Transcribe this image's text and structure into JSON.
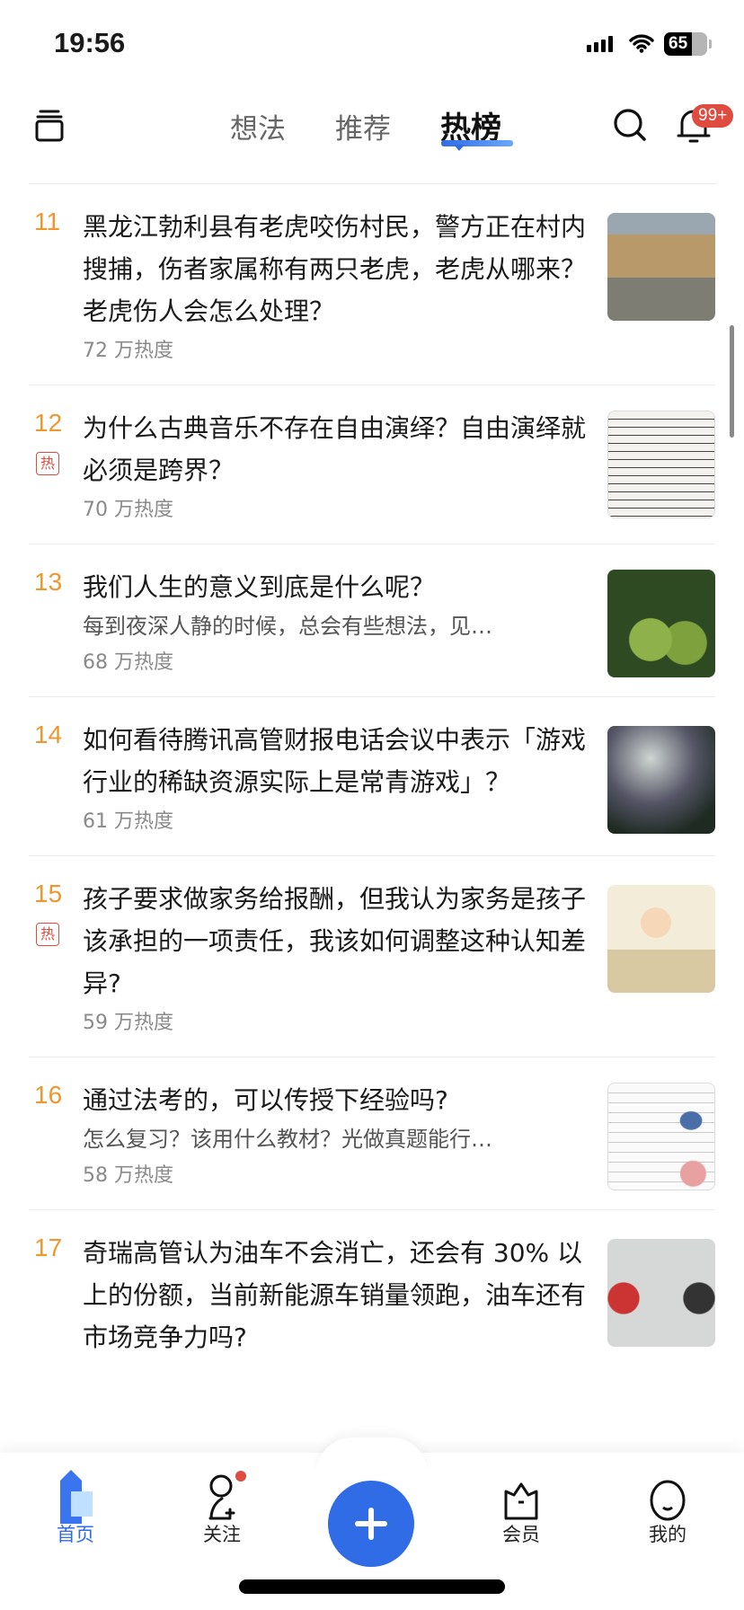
{
  "status_bar": {
    "time": "19:56",
    "battery": "65"
  },
  "header": {
    "tabs": [
      {
        "label": "想法"
      },
      {
        "label": "推荐"
      },
      {
        "label": "热榜"
      }
    ],
    "notification_badge": "99+"
  },
  "hot_list": [
    {
      "rank": "11",
      "title": "黑龙江勃利县有老虎咬伤村民，警方正在村内搜捕，伤者家属称有两只老虎，老虎从哪来？老虎伤人会怎么处理？",
      "heat": "72 万热度",
      "hot": false
    },
    {
      "rank": "12",
      "title": "为什么古典音乐不存在自由演绎？自由演绎就必须是跨界？",
      "heat": "70 万热度",
      "hot": true,
      "hot_label": "热"
    },
    {
      "rank": "13",
      "title": "我们人生的意义到底是什么呢？",
      "desc": "每到夜深人静的时候，总会有些想法，见…",
      "heat": "68 万热度",
      "hot": false
    },
    {
      "rank": "14",
      "title": "如何看待腾讯高管财报电话会议中表示「游戏行业的稀缺资源实际上是常青游戏」？",
      "heat": "61 万热度",
      "hot": false
    },
    {
      "rank": "15",
      "title": "孩子要求做家务给报酬，但我认为家务是孩子该承担的一项责任，我该如何调整这种认知差异?",
      "heat": "59 万热度",
      "hot": true,
      "hot_label": "热"
    },
    {
      "rank": "16",
      "title": "通过法考的，可以传授下经验吗?",
      "desc": "怎么复习？该用什么教材？光做真题能行…",
      "heat": "58 万热度",
      "hot": false
    },
    {
      "rank": "17",
      "title": "奇瑞高管认为油车不会消亡，还会有 30% 以上的份额，当前新能源车销量领跑，油车还有市场竞争力吗?",
      "heat": "",
      "hot": false
    }
  ],
  "tab_bar": {
    "items": [
      {
        "label": "首页"
      },
      {
        "label": "关注"
      },
      {
        "label": "会员"
      },
      {
        "label": "我的"
      }
    ]
  },
  "colors": {
    "accent": "#2f6ce5",
    "rank": "#f0962c",
    "hot": "#e04b3f"
  }
}
